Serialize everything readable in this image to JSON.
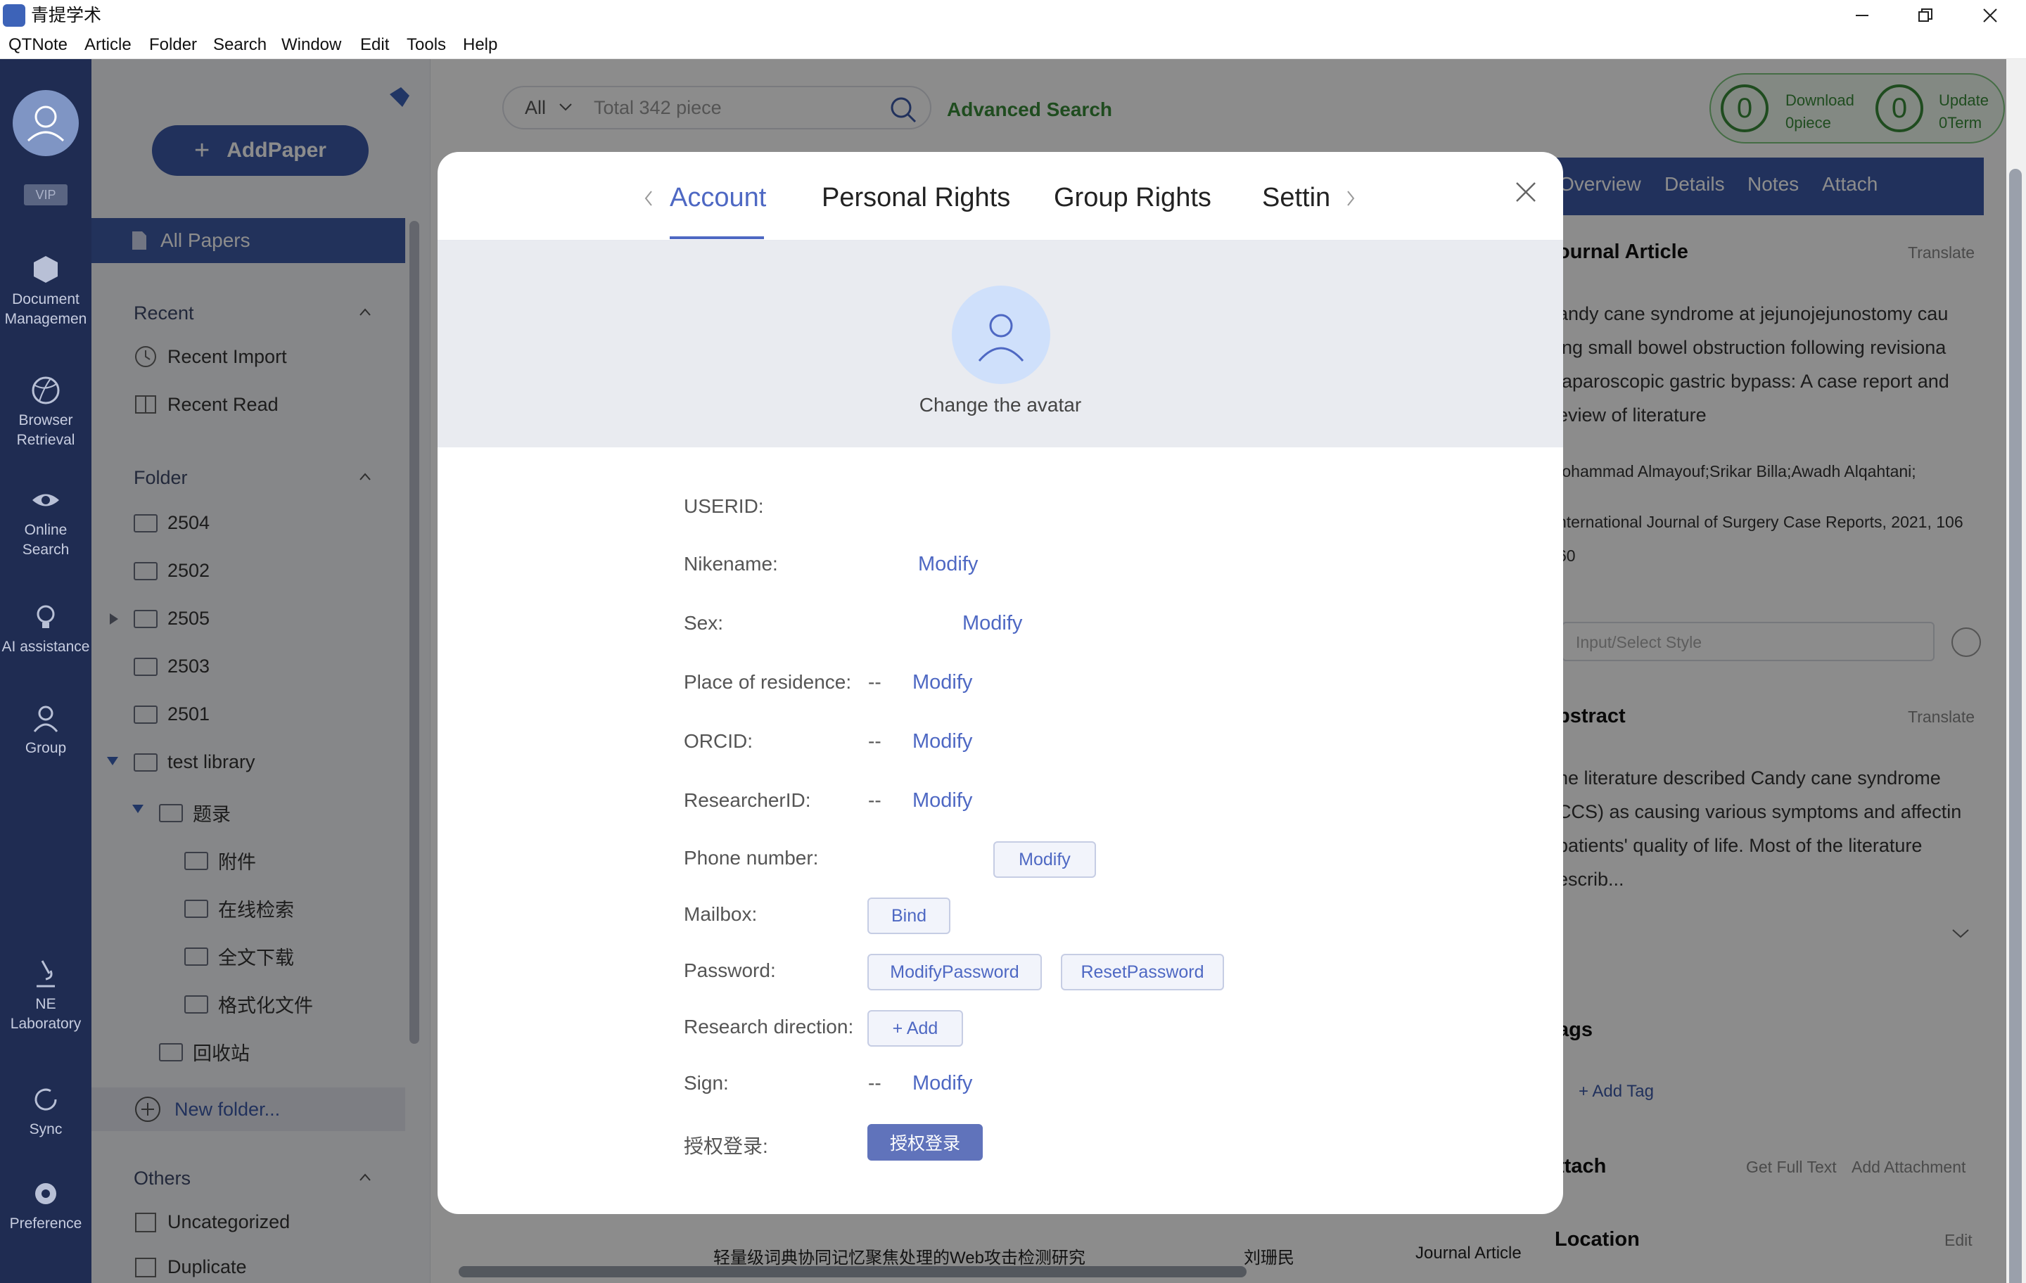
{
  "app": {
    "title": "青提学术"
  },
  "menu": [
    "QTNote",
    "Article",
    "Folder",
    "Search",
    "Window",
    "Edit",
    "Tools",
    "Help"
  ],
  "nav": {
    "vip": "VIP",
    "items": [
      {
        "label1": "Document",
        "label2": "Managemen"
      },
      {
        "label1": "Browser",
        "label2": "Retrieval"
      },
      {
        "label1": "Online",
        "label2": "Search"
      },
      {
        "label1": "AI assistance",
        "label2": ""
      },
      {
        "label1": "Group",
        "label2": ""
      },
      {
        "label1": "NE",
        "label2": "Laboratory"
      },
      {
        "label1": "Sync",
        "label2": ""
      },
      {
        "label1": "Preference",
        "label2": ""
      }
    ]
  },
  "sidebar": {
    "add_paper": "AddPaper",
    "all_papers": "All Papers",
    "recent_header": "Recent",
    "recent_import": "Recent Import",
    "recent_read": "Recent Read",
    "folder_header": "Folder",
    "folders": [
      "2504",
      "2502",
      "2505",
      "2503",
      "2501",
      "test library",
      "题录",
      "附件",
      "在线检索",
      "全文下载",
      "格式化文件",
      "回收站"
    ],
    "new_folder": "New folder...",
    "others_header": "Others",
    "uncategorized": "Uncategorized",
    "duplicate": "Duplicate"
  },
  "search": {
    "scope": "All",
    "placeholder": "Total 342 piece",
    "advanced": "Advanced Search",
    "download_count": "0",
    "download_label": "Download",
    "download_unit": "0piece",
    "update_count": "0",
    "update_label": "Update",
    "update_unit": "0Term"
  },
  "bottom_row": {
    "title": "轻量级词典协同记忆聚焦处理的Web攻击检测研究",
    "author": "刘珊民",
    "type": "Journal Article"
  },
  "modal": {
    "tabs": [
      "Account",
      "Personal Rights",
      "Group Rights",
      "Settin"
    ],
    "change_avatar": "Change the avatar",
    "fields": {
      "userid": "USERID:",
      "nikename": "Nikename:",
      "sex": "Sex:",
      "residence": "Place of residence:",
      "orcid": "ORCID:",
      "researcherid": "ResearcherID:",
      "phone": "Phone number:",
      "mailbox": "Mailbox:",
      "password": "Password:",
      "direction": "Research direction:",
      "sign": "Sign:",
      "auth": "授权登录:"
    },
    "dash": "--",
    "modify": "Modify",
    "bind": "Bind",
    "modify_password": "ModifyPassword",
    "reset_password": "ResetPassword",
    "add": "+ Add",
    "auth_button": "授权登录"
  },
  "right_panel": {
    "tabs": [
      "Overview",
      "Details",
      "Notes",
      "Attach"
    ],
    "type_heading": "ournal Article",
    "translate": "Translate",
    "title_lines": [
      "andy cane syndrome at jejunojejunostomy cau",
      "ing small bowel obstruction following revisiona",
      "laparoscopic gastric bypass: A case report and",
      "eview of literature"
    ],
    "authors": "Iohammad Almayouf;Srikar Billa;Awadh Alqahtani;",
    "journal_line1": "nternational Journal of Surgery Case Reports, 2021, 106",
    "journal_line2": "60",
    "style_placeholder": "Input/Select Style",
    "abstract_heading": "bstract",
    "abstract_lines": [
      "he literature described Candy cane syndrome",
      "CCS) as causing various symptoms and affectin",
      "patients' quality of life. Most of the literature",
      "escrib..."
    ],
    "tags_heading": "ags",
    "add_tag": "+ Add Tag",
    "attach_heading": "ttach",
    "get_full_text": "Get Full Text",
    "add_attachment": "Add Attachment",
    "location_heading": "Location",
    "edit": "Edit"
  }
}
